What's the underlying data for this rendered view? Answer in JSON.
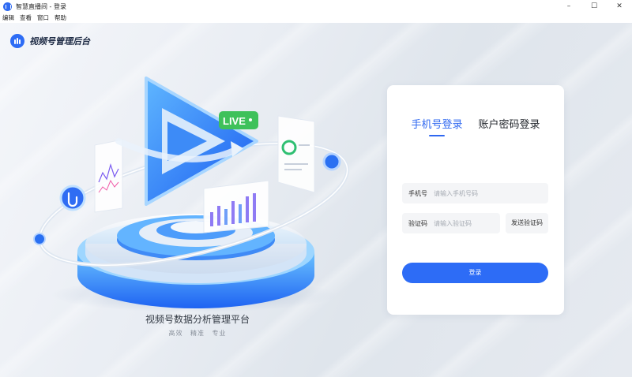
{
  "window": {
    "title": "智慧直播间 - 登录",
    "controls": {
      "minimize": "–",
      "maximize": "☐",
      "close": "✕"
    }
  },
  "menu": [
    "编辑",
    "查看",
    "窗口",
    "帮助"
  ],
  "brand": {
    "name": "视频号管理后台"
  },
  "hero": {
    "slogan": "视频号数据分析管理平台",
    "tags": [
      "高效",
      "精准",
      "专业"
    ],
    "live_badge": "LIVE"
  },
  "login": {
    "tabs": [
      {
        "label": "手机号登录",
        "active": true
      },
      {
        "label": "账户密码登录",
        "active": false
      }
    ],
    "phone_label": "手机号",
    "phone_placeholder": "请输入手机号码",
    "code_label": "验证码",
    "code_placeholder": "请输入验证码",
    "send_code": "发送验证码",
    "submit": "登录"
  },
  "colors": {
    "accent": "#2d6cf6",
    "live_green": "#3ec15a"
  }
}
